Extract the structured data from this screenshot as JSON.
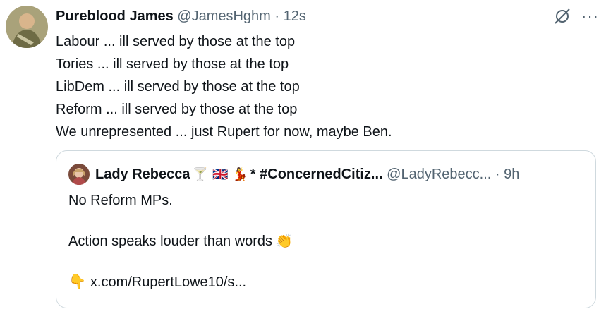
{
  "tweet": {
    "name": "Pureblood James",
    "handle": "@JamesHghm",
    "dot": "·",
    "time": "12s",
    "lines": [
      "Labour ... ill served by those at the top",
      "Tories ... ill served by those at the top",
      "LibDem ... ill served by those at the top",
      "Reform ... ill served by those at the top",
      "We unrepresented ... just Rupert for now, maybe Ben."
    ],
    "more_icon": "···"
  },
  "quote": {
    "name": "Lady Rebecca",
    "emojis": [
      "🍸",
      "🇬🇧",
      "💃"
    ],
    "name_suffix": "* #ConcernedCitiz...",
    "handle": "@LadyRebecc...",
    "dot": "·",
    "time": "9h",
    "line1": "No Reform MPs.",
    "line2": "Action speaks louder than words",
    "clap_emoji": "👏",
    "point_emoji": "👇",
    "link": "x.com/RupertLowe10/s..."
  },
  "colors": {
    "text": "#0f1419",
    "muted": "#536471",
    "border": "#cfd9de"
  }
}
